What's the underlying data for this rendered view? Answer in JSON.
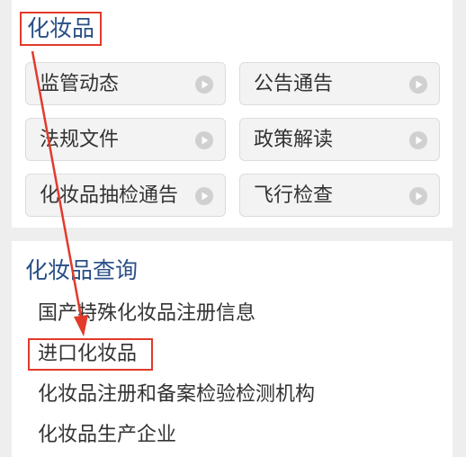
{
  "section": {
    "title": "化妆品"
  },
  "buttons": [
    {
      "label": "监管动态"
    },
    {
      "label": "公告通告"
    },
    {
      "label": "法规文件"
    },
    {
      "label": "政策解读"
    },
    {
      "label": "化妆品抽检通告"
    },
    {
      "label": "飞行检查"
    }
  ],
  "query": {
    "title": "化妆品查询",
    "links": [
      {
        "label": "国产特殊化妆品注册信息"
      },
      {
        "label": "进口化妆品"
      },
      {
        "label": "化妆品注册和备案检验检测机构"
      },
      {
        "label": "化妆品生产企业"
      }
    ]
  },
  "icon": {
    "name": "play-circle-icon"
  },
  "colors": {
    "accent": "#2a4f86",
    "annotation": "#e23a2b",
    "button_bg": "#f3f3f3"
  }
}
